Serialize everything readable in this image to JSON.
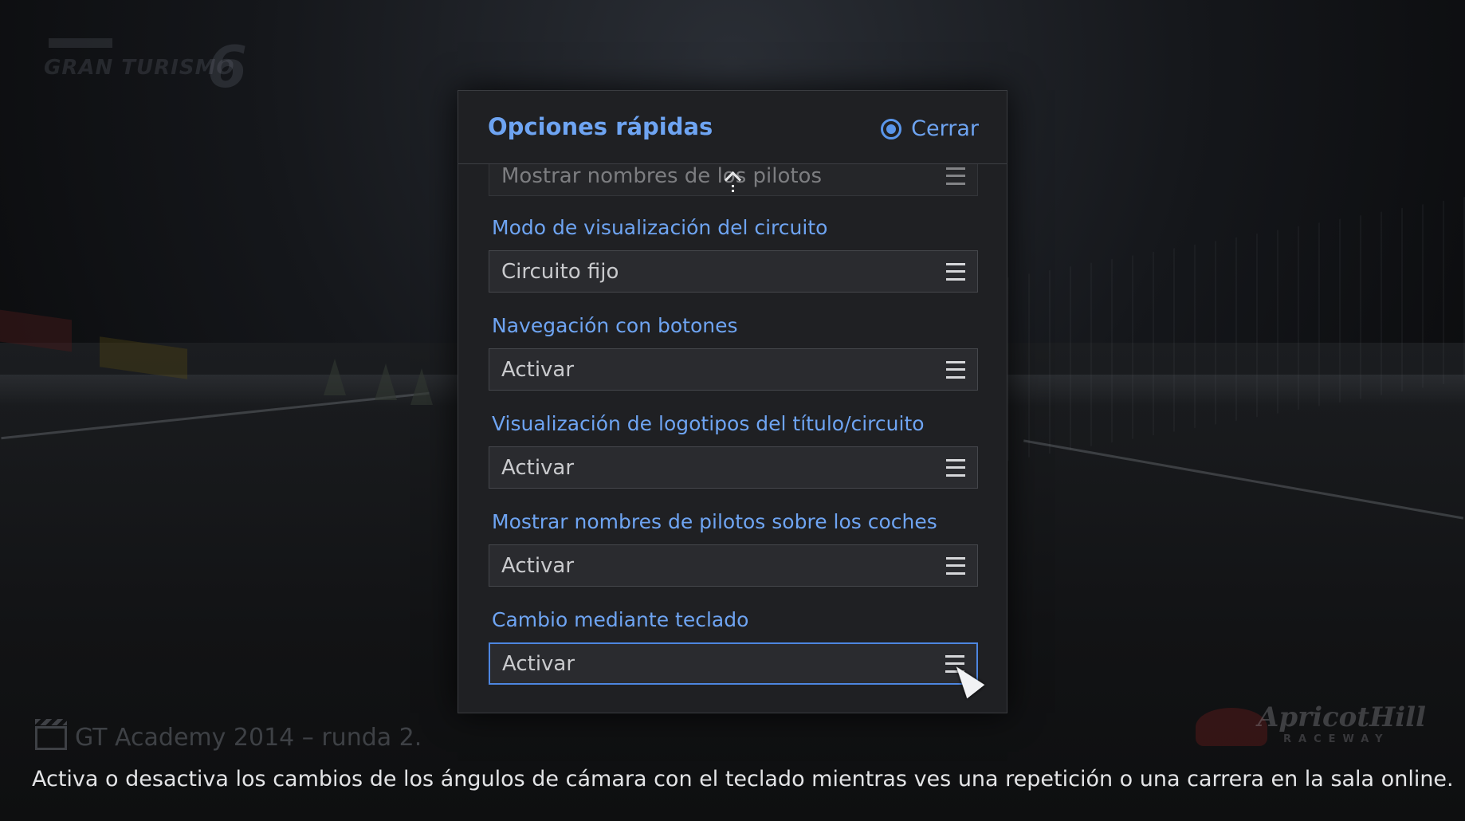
{
  "background": {
    "event_title": "GT Academy 2014 – runda 2."
  },
  "dialog": {
    "title": "Opciones rápidas",
    "close_label": "Cerrar",
    "partial_option_value": "Mostrar nombres de los pilotos",
    "options": [
      {
        "label": "Modo de visualización del circuito",
        "value": "Circuito fijo"
      },
      {
        "label": "Navegación con botones",
        "value": "Activar"
      },
      {
        "label": "Visualización de logotipos del título/circuito",
        "value": "Activar"
      },
      {
        "label": "Mostrar nombres de pilotos sobre los coches",
        "value": "Activar"
      },
      {
        "label": "Cambio mediante teclado",
        "value": "Activar",
        "focused": true
      }
    ]
  },
  "help_text": "Activa o desactiva los cambios de los ángulos de cámara con el teclado mientras ves una repetición o una carrera en la sala online.",
  "colors": {
    "accent": "#6ea4f2",
    "panel": "#1f2023",
    "field": "#2a2b2f",
    "focus_border": "#4d86e0"
  }
}
